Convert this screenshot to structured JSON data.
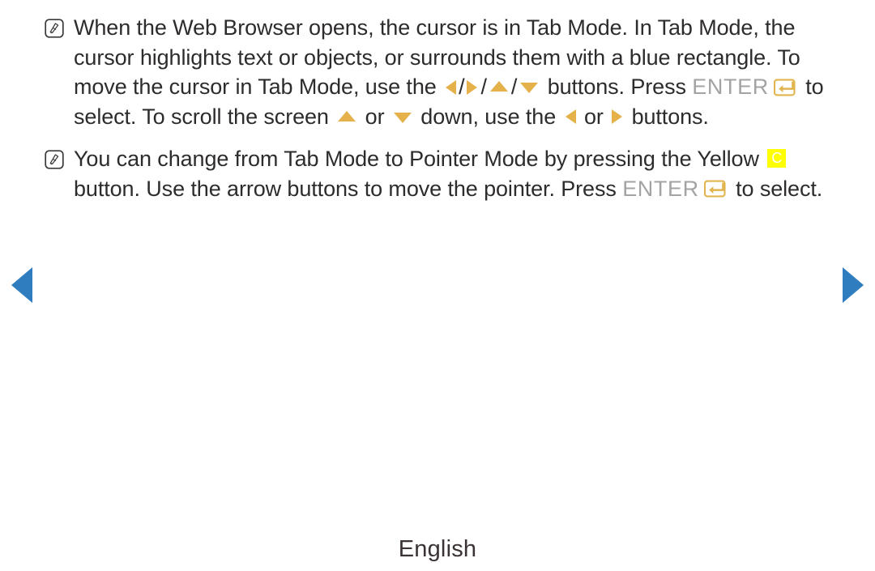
{
  "page": {
    "language_footer": "English",
    "background_color": "#ffffff",
    "text_color": "#2e2b2b"
  },
  "colors": {
    "arrow_amber": "#e4b14a",
    "enter_text_gray": "#a3a3a3",
    "enter_border_gold": "#e0b44e",
    "yellow_button": "#ffff00",
    "nav_blue": "#2f7cbf"
  },
  "notes": [
    {
      "icon": "note-pencil-icon",
      "segments": [
        {
          "type": "text",
          "value": "When the Web Browser opens, the cursor is in Tab Mode. In Tab Mode, the cursor highlights text or objects, or surrounds them with a blue rectangle. To move the cursor in Tab Mode, use the "
        },
        {
          "type": "icon",
          "value": "arrow-left-icon"
        },
        {
          "type": "text",
          "value": " / "
        },
        {
          "type": "icon",
          "value": "arrow-right-icon"
        },
        {
          "type": "text",
          "value": " / "
        },
        {
          "type": "icon",
          "value": "arrow-up-icon"
        },
        {
          "type": "text",
          "value": " / "
        },
        {
          "type": "icon",
          "value": "arrow-down-icon"
        },
        {
          "type": "text",
          "value": " buttons. Press "
        },
        {
          "type": "label",
          "value": "ENTER"
        },
        {
          "type": "icon",
          "value": "enter-key-icon"
        },
        {
          "type": "text",
          "value": " to select. To scroll the screen "
        },
        {
          "type": "icon",
          "value": "arrow-up-icon"
        },
        {
          "type": "text",
          "value": " or "
        },
        {
          "type": "icon",
          "value": "arrow-down-icon"
        },
        {
          "type": "text",
          "value": " down, use the "
        },
        {
          "type": "icon",
          "value": "arrow-left-icon"
        },
        {
          "type": "text",
          "value": " or "
        },
        {
          "type": "icon",
          "value": "arrow-right-icon"
        },
        {
          "type": "text",
          "value": " buttons."
        }
      ]
    },
    {
      "icon": "note-pencil-icon",
      "segments": [
        {
          "type": "text",
          "value": "You can change from Tab Mode to Pointer Mode by pressing the Yellow "
        },
        {
          "type": "color-button",
          "value": "C"
        },
        {
          "type": "text",
          "value": " button. Use the arrow buttons to move the pointer. Press "
        },
        {
          "type": "label",
          "value": "ENTER"
        },
        {
          "type": "icon",
          "value": "enter-key-icon"
        },
        {
          "type": "text",
          "value": " to select."
        }
      ]
    }
  ],
  "note_text_1": {
    "part1": "When the Web Browser opens, the cursor is in Tab Mode. In Tab Mode, the cursor highlights text or objects, or surrounds them with a blue rectangle. To move the cursor in Tab Mode, use the",
    "sep1": "/",
    "sep2": "/",
    "sep3": "/",
    "part2": "buttons. Press",
    "enter": "ENTER",
    "part3": "to select. To scroll the screen",
    "or1": "or",
    "part4": "down, use the",
    "or2": "or",
    "part5": "buttons."
  },
  "note_text_2": {
    "part1": "You can change from Tab Mode to Pointer Mode by pressing the Yellow",
    "color_button": "C",
    "part2": "button. Use the arrow buttons to move the pointer. Press",
    "enter": "ENTER",
    "part3": "to select."
  },
  "navigation": {
    "previous_label": "previous-page-arrow",
    "next_label": "next-page-arrow"
  }
}
